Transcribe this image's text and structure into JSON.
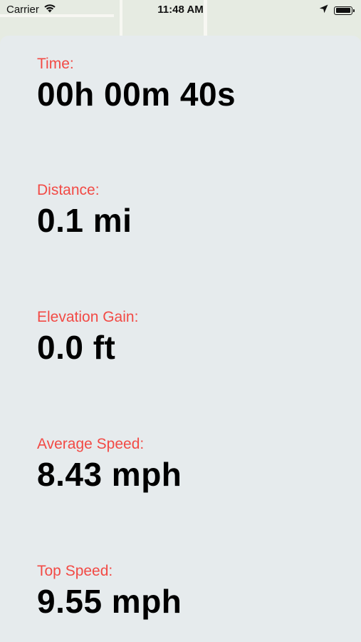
{
  "status_bar": {
    "carrier": "Carrier",
    "time": "11:48 AM",
    "wifi_icon": "wifi-icon",
    "location_icon": "location-arrow-icon",
    "battery_icon": "battery-icon",
    "battery_level": 1.0
  },
  "stats": [
    {
      "label": "Time:",
      "value": "00h 00m 40s"
    },
    {
      "label": "Distance:",
      "value": "0.1 mi"
    },
    {
      "label": "Elevation Gain:",
      "value": "0.0 ft"
    },
    {
      "label": "Average Speed:",
      "value": "8.43 mph"
    },
    {
      "label": "Top Speed:",
      "value": "9.55 mph"
    }
  ],
  "colors": {
    "label": "#f24a45",
    "value": "#000000",
    "sheet_background": "#e6ebed"
  }
}
